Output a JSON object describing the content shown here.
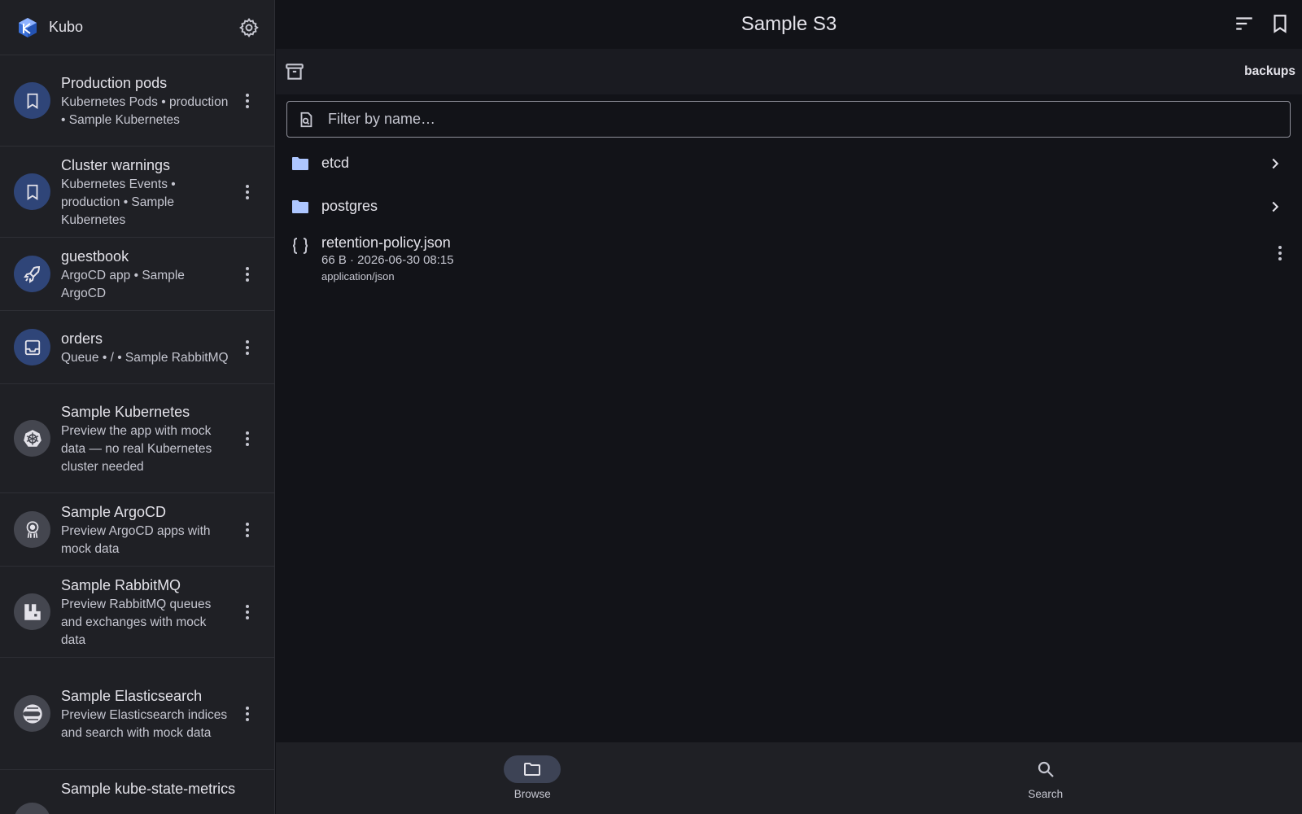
{
  "app": {
    "title": "Kubo"
  },
  "sidebar": {
    "items": [
      {
        "title": "Production pods",
        "subtitle": "Kubernetes Pods • production • Sample Kubernetes",
        "icon": "bookmark-icon"
      },
      {
        "title": "Cluster warnings",
        "subtitle": "Kubernetes Events • production • Sample Kubernetes",
        "icon": "bookmark-icon"
      },
      {
        "title": "guestbook",
        "subtitle": "ArgoCD app • Sample ArgoCD",
        "icon": "rocket-icon"
      },
      {
        "title": "orders",
        "subtitle": "Queue • / • Sample RabbitMQ",
        "icon": "inbox-icon"
      },
      {
        "title": "Sample Kubernetes",
        "subtitle": "Preview the app with mock data — no real Kubernetes cluster needed",
        "icon": "kubernetes-icon"
      },
      {
        "title": "Sample ArgoCD",
        "subtitle": "Preview ArgoCD apps with mock data",
        "icon": "argocd-icon"
      },
      {
        "title": "Sample RabbitMQ",
        "subtitle": "Preview RabbitMQ queues and exchanges with mock data",
        "icon": "rabbitmq-icon"
      },
      {
        "title": "Sample Elasticsearch",
        "subtitle": "Preview Elasticsearch indices and search with mock data",
        "icon": "elasticsearch-icon"
      },
      {
        "title": "Sample kube-state-metrics",
        "subtitle": "",
        "icon": "metrics-icon"
      }
    ]
  },
  "header": {
    "title": "Sample S3"
  },
  "subbar": {
    "bucket": "backups"
  },
  "filter": {
    "placeholder": "Filter by name…"
  },
  "entries": {
    "folders": [
      {
        "name": "etcd"
      },
      {
        "name": "postgres"
      }
    ],
    "files": [
      {
        "name": "retention-policy.json",
        "meta": "66 B · 2026-06-30 08:15",
        "mime": "application/json"
      }
    ]
  },
  "bottomnav": {
    "browse": "Browse",
    "search": "Search"
  },
  "colors": {
    "accent": "#adc6ff",
    "avatar_blue": "#2f4578",
    "background": "#121318"
  }
}
